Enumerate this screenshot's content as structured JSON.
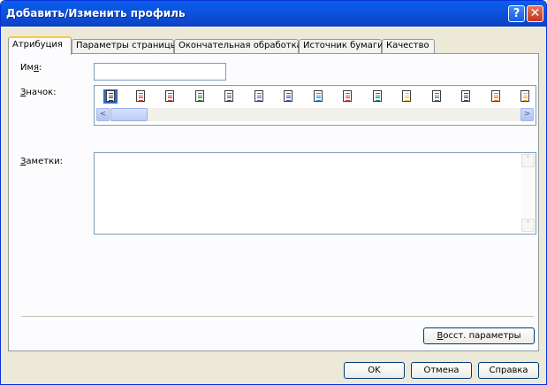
{
  "window": {
    "title": "Добавить/Изменить профиль",
    "help_label": "?",
    "close_label": "✕"
  },
  "tabs": [
    {
      "label": "Атрибуция",
      "active": true
    },
    {
      "label": "Параметры страницы",
      "active": false
    },
    {
      "label": "Окончательная обработка",
      "active": false
    },
    {
      "label": "Источник бумаги",
      "active": false
    },
    {
      "label": "Качество",
      "active": false
    }
  ],
  "form": {
    "name_label_pre": "Им",
    "name_label_key": "я",
    "name_label_post": ":",
    "name_value": "",
    "icon_label_key": "З",
    "icon_label_post": "начок:",
    "notes_label_key": "З",
    "notes_label_pre": "",
    "notes_label_post": "аметки:",
    "notes_value": "",
    "icons": [
      "document-icon",
      "document-colored-icon",
      "image-document-icon",
      "photo-icon",
      "long-document-icon",
      "multipage-icon",
      "brochure-icon",
      "a4-paper-icon",
      "calendar-icon",
      "envelope-icon",
      "color-photo-icon",
      "booklet-icon",
      "layered-icon",
      "color-palette-icon",
      "stamp-icon"
    ],
    "selected_icon_index": 0,
    "scroll_left_label": "<",
    "scroll_right_label": ">",
    "scroll_up_label": "˄",
    "scroll_down_label": "˅",
    "restore_key": "В",
    "restore_label_post": "осст. параметры"
  },
  "buttons": {
    "ok": "OK",
    "cancel": "Отмена",
    "help": "Справка"
  },
  "colors": {
    "titlebar": "#0b55e0",
    "selection": "#316ac5",
    "active_tab_accent": "#ffc83c"
  }
}
